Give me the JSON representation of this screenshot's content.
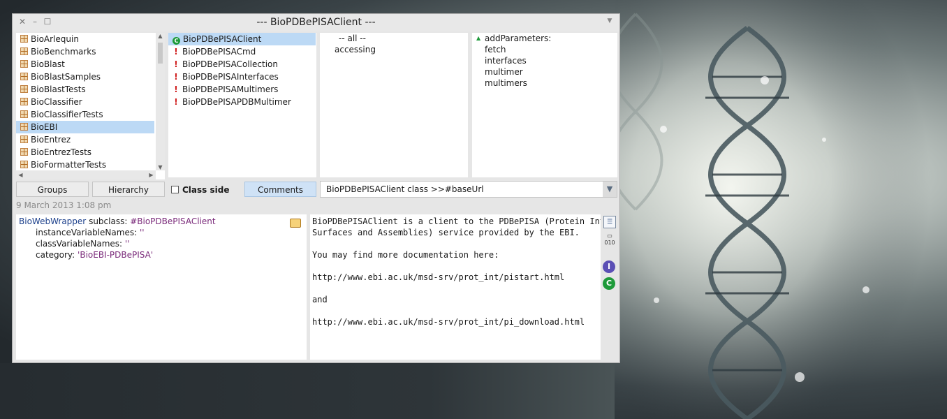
{
  "window": {
    "title": "--- BioPDBePISAClient ---"
  },
  "packages": {
    "items": [
      "BioArlequin",
      "BioBenchmarks",
      "BioBlast",
      "BioBlastSamples",
      "BioBlastTests",
      "BioClassifier",
      "BioClassifierTests",
      "BioEBI",
      "BioEntrez",
      "BioEntrezTests",
      "BioFormatterTests"
    ],
    "selected": "BioEBI"
  },
  "classes": {
    "items": [
      {
        "name": "BioPDBePISAClient",
        "icon": "class-icon",
        "selected": true
      },
      {
        "name": "BioPDBePISACmd",
        "icon": "warning-icon"
      },
      {
        "name": "BioPDBePISACollection",
        "icon": "warning-icon"
      },
      {
        "name": "BioPDBePISAInterfaces",
        "icon": "warning-icon"
      },
      {
        "name": "BioPDBePISAMultimers",
        "icon": "warning-icon"
      },
      {
        "name": "BioPDBePISAPDBMultimer",
        "icon": "warning-icon"
      }
    ]
  },
  "protocols": {
    "items": [
      "-- all --",
      "accessing"
    ]
  },
  "methods": {
    "items": [
      "addParameters:",
      "fetch",
      "interfaces",
      "multimer",
      "multimers"
    ]
  },
  "buttons": {
    "groups": "Groups",
    "hierarchy": "Hierarchy",
    "class_side": "Class side",
    "comments": "Comments"
  },
  "method_selector": {
    "value": "BioPDBePISAClient class >>#baseUrl"
  },
  "timestamp": "9 March 2013 1:08 pm",
  "definition": {
    "superclass": "BioWebWrapper",
    "subclass_kw": "subclass:",
    "class_symbol": "#BioPDBePISAClient",
    "ivars_kw": "instanceVariableNames:",
    "ivars_val": "''",
    "cvars_kw": "classVariableNames:",
    "cvars_val": "''",
    "category_kw": "category:",
    "category_val": "'BioEBI-PDBePISA'"
  },
  "comment": {
    "lines": [
      "BioPDBePISAClient is a client to the PDBePISA (Protein Interfaces,",
      "Surfaces and Assemblies) service provided by the EBI.",
      "",
      "You may find more documentation here:",
      "",
      "http://www.ebi.ac.uk/msd-srv/prot_int/pistart.html",
      "",
      "and",
      "",
      "http://www.ebi.ac.uk/msd-srv/prot_int/pi_download.html"
    ]
  },
  "colors": {
    "selection": "#bcd9f5",
    "accent_green": "#1e9a3a",
    "symbol_purple": "#7a2a7a"
  }
}
